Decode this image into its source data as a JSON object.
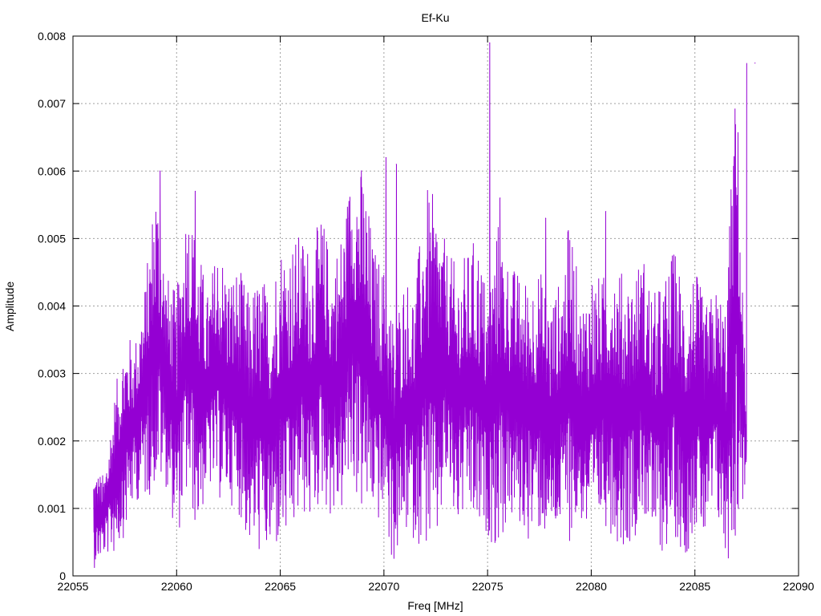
{
  "chart_data": {
    "type": "line",
    "title": "Ef-Ku",
    "xlabel": "Freq [MHz]",
    "ylabel": "Amplitude",
    "xlim": [
      22055,
      22090
    ],
    "ylim": [
      0,
      0.008
    ],
    "xticks": [
      "22055",
      "22060",
      "22065",
      "22070",
      "22075",
      "22080",
      "22085",
      "22090"
    ],
    "yticks": [
      "0",
      "0.001",
      "0.002",
      "0.003",
      "0.004",
      "0.005",
      "0.006",
      "0.007",
      "0.008"
    ],
    "grid": true,
    "legend": "none",
    "series": [
      {
        "color": "#9400d3",
        "x_start": 22056.0,
        "x_step": 0.5,
        "envelope_max": [
          0.0016,
          0.0015,
          0.0027,
          0.0036,
          0.0035,
          0.0044,
          0.006,
          0.0045,
          0.0042,
          0.0057,
          0.005,
          0.0042,
          0.005,
          0.0045,
          0.0046,
          0.0042,
          0.0045,
          0.0043,
          0.005,
          0.005,
          0.0051,
          0.0049,
          0.0054,
          0.0047,
          0.0052,
          0.0062,
          0.0061,
          0.0049,
          0.0046,
          0.0038,
          0.0045,
          0.0043,
          0.0058,
          0.0056,
          0.0049,
          0.0046,
          0.0048,
          0.0051,
          0.0042,
          0.0053,
          0.0047,
          0.0045,
          0.0044,
          0.0046,
          0.0041,
          0.0044,
          0.0054,
          0.004,
          0.0046,
          0.0044,
          0.0048,
          0.0045,
          0.0045,
          0.0048,
          0.0042,
          0.0044,
          0.0049,
          0.0043,
          0.0046,
          0.004,
          0.0043,
          0.0041,
          0.0076,
          0.0023
        ],
        "envelope_min": [
          0.0001,
          0.0003,
          0.0003,
          0.0006,
          0.0011,
          0.0011,
          0.0013,
          0.0013,
          0.0005,
          0.0011,
          0.0006,
          0.0013,
          0.0011,
          0.0011,
          0.0009,
          0.0004,
          0.0003,
          0.0002,
          0.0004,
          0.0004,
          0.0009,
          0.0007,
          0.0011,
          0.0008,
          0.0009,
          0.0013,
          0.0008,
          0.0009,
          0.0006,
          0.0001,
          0.0006,
          0.0005,
          0.0004,
          0.0002,
          0.0013,
          0.0006,
          0.0009,
          0.0005,
          0.0006,
          0.0003,
          0.0008,
          0.0007,
          0.0005,
          0.0006,
          0.0005,
          0.0006,
          0.0005,
          0.0008,
          0.0003,
          0.0008,
          0.0006,
          0.0004,
          0.0005,
          0.0009,
          0.0004,
          0.0003,
          0.0006,
          0.0002,
          0.0007,
          0.0004,
          0.0009,
          0.0001,
          0.0005,
          0.0014
        ],
        "peaks": [
          {
            "x": 22059.2,
            "y": 0.006
          },
          {
            "x": 22060.9,
            "y": 0.0057
          },
          {
            "x": 22068.3,
            "y": 0.0053
          },
          {
            "x": 22070.1,
            "y": 0.0062
          },
          {
            "x": 22070.6,
            "y": 0.0061
          },
          {
            "x": 22075.1,
            "y": 0.0079
          },
          {
            "x": 22075.6,
            "y": 0.0056
          },
          {
            "x": 22077.8,
            "y": 0.0053
          },
          {
            "x": 22080.7,
            "y": 0.0054
          },
          {
            "x": 22087.9,
            "y": 0.0076
          }
        ]
      }
    ]
  }
}
